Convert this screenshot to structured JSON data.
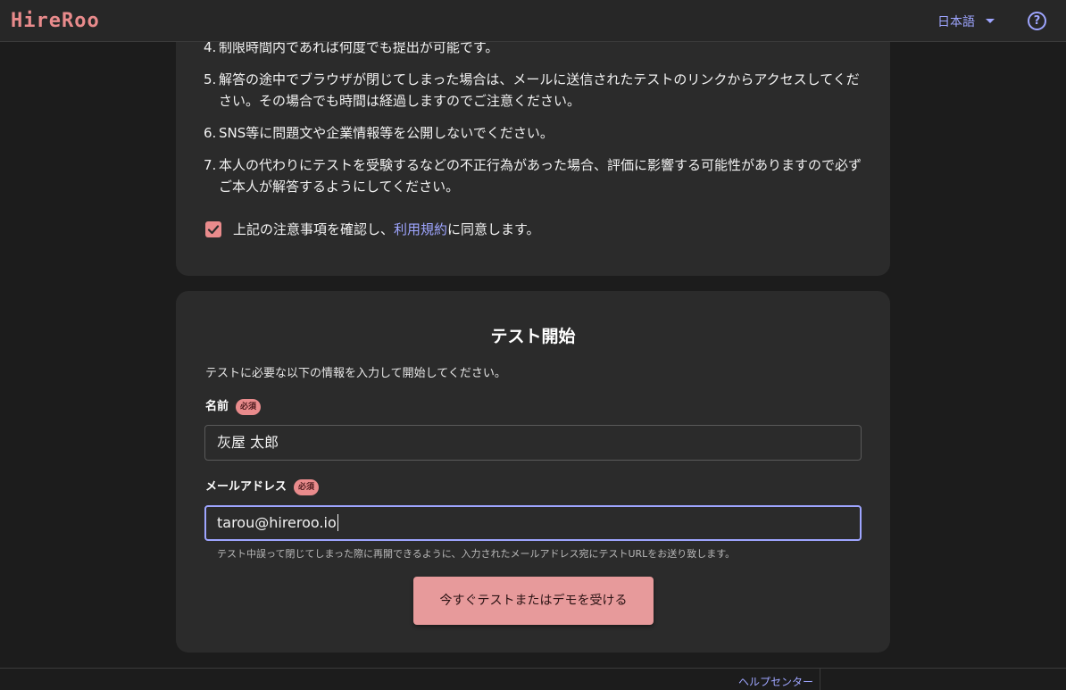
{
  "header": {
    "logo": "HireRoo",
    "language": "日本語",
    "help_glyph": "?",
    "icons": {
      "language_toggle": "chevron-down-icon",
      "help": "help-circle-icon"
    }
  },
  "rules": {
    "items": [
      {
        "num": "4.",
        "text": "制限時間内であれば何度でも提出が可能です。"
      },
      {
        "num": "5.",
        "text": "解答の途中でブラウザが閉じてしまった場合は、メールに送信されたテストのリンクからアクセスしてください。その場合でも時間は経過しますのでご注意ください。"
      },
      {
        "num": "6.",
        "text": "SNS等に問題文や企業情報等を公開しないでください。"
      },
      {
        "num": "7.",
        "text": "本人の代わりにテストを受験するなどの不正行為があった場合、評価に影響する可能性がありますので必ずご本人が解答するようにしてください。"
      }
    ],
    "agree_prefix": "上記の注意事項を確認し、",
    "agree_link": "利用規約",
    "agree_suffix": "に同意します。",
    "agree_checked": true
  },
  "start": {
    "title": "テスト開始",
    "description": "テストに必要な以下の情報を入力して開始してください。",
    "name_label": "名前",
    "required_badge": "必須",
    "name_value": "灰屋 太郎",
    "email_label": "メールアドレス",
    "email_value": "tarou@hireroo.io",
    "email_hint": "テスト中誤って閉じてしまった際に再開できるように、入力されたメールアドレス宛にテストURLをお送り致します。",
    "cta_label": "今すぐテストまたはデモを受ける"
  },
  "footer": {
    "help_center": "ヘルプセンター"
  },
  "colors": {
    "accent": "#e98b8c",
    "link": "#9ea5ff",
    "background": "#1c1c1c",
    "card": "#2b2b2b"
  }
}
